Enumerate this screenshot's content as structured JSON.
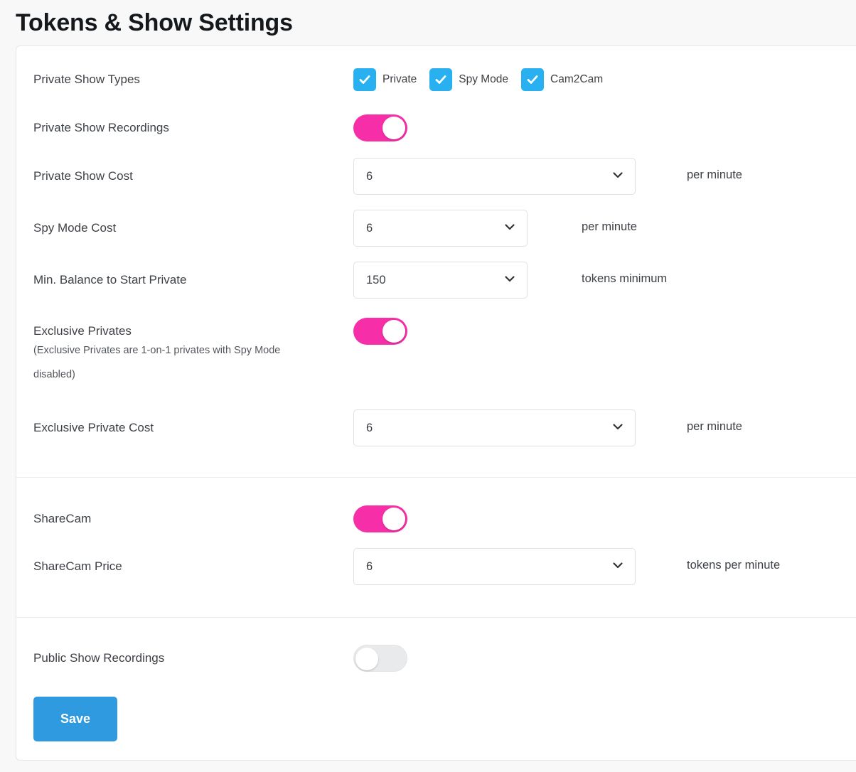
{
  "page": {
    "title": "Tokens & Show Settings"
  },
  "theme": {
    "accent_blue": "#29b0f1",
    "toggle_on_pink": "#f62ea7",
    "toggle_off_gray": "#e9eaec",
    "save_button_blue": "#2f9ae0",
    "page_background": "#f8f8f9",
    "card_background": "#ffffff"
  },
  "sections": {
    "private": {
      "show_types": {
        "label": "Private Show Types",
        "options": [
          {
            "label": "Private",
            "checked": true
          },
          {
            "label": "Spy Mode",
            "checked": true
          },
          {
            "label": "Cam2Cam",
            "checked": true
          }
        ]
      },
      "recordings": {
        "label": "Private Show Recordings",
        "state": "on"
      },
      "private_show_cost": {
        "label": "Private Show Cost",
        "value": "6",
        "suffix": "per minute"
      },
      "spy_mode_cost": {
        "label": "Spy Mode Cost",
        "value": "6",
        "suffix": "per minute"
      },
      "min_balance": {
        "label": "Min. Balance to Start Private",
        "value": "150",
        "suffix": "tokens minimum"
      },
      "exclusive_privates": {
        "label": "Exclusive Privates",
        "help": "(Exclusive Privates are 1-on-1 privates with Spy Mode disabled)",
        "state": "on"
      },
      "exclusive_private_cost": {
        "label": "Exclusive Private Cost",
        "value": "6",
        "suffix": "per minute"
      }
    },
    "sharecam": {
      "toggle": {
        "label": "ShareCam",
        "state": "on"
      },
      "price": {
        "label": "ShareCam Price",
        "value": "6",
        "suffix": "tokens per minute"
      }
    },
    "public": {
      "recordings": {
        "label": "Public Show Recordings",
        "state": "off"
      },
      "save_label": "Save"
    }
  }
}
